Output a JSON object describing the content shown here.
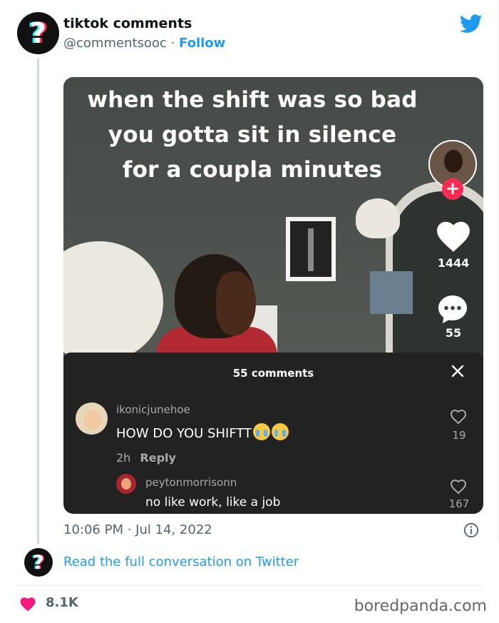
{
  "author": {
    "display_name": "tiktok comments",
    "handle": "@commentsooc",
    "separator": "·",
    "follow_label": "Follow",
    "avatar_icon": "question-mark-icon",
    "avatar_glyph": "?"
  },
  "media": {
    "caption_lines": [
      "when the shift was so bad",
      "you gotta sit in silence",
      "for a coupla minutes"
    ],
    "tiktok": {
      "follow_plus": "+",
      "likes": "1444",
      "comments": "55"
    },
    "comment_sheet": {
      "title": "55 comments",
      "comments": [
        {
          "username": "ikonicjunehoe",
          "text": "HOW DO YOU SHIFTT",
          "emoji": "loudly-crying-face-icon",
          "time": "2h",
          "reply_label": "Reply",
          "likes": "19"
        },
        {
          "username": "peytonmorrisonn",
          "text": "no like work, like a job",
          "likes": "167"
        }
      ]
    }
  },
  "tweet": {
    "timestamp": "10:06 PM · Jul 14, 2022",
    "read_more": "Read the full conversation on Twitter",
    "like_count": "8.1K"
  },
  "watermark": "boredpanda.com",
  "colors": {
    "twitter_blue": "#1d9bf0",
    "like_red": "#f91880",
    "tiktok_red": "#fe2c55",
    "tiktok_cyan": "#25f4ee",
    "sheet_bg": "#222222"
  }
}
